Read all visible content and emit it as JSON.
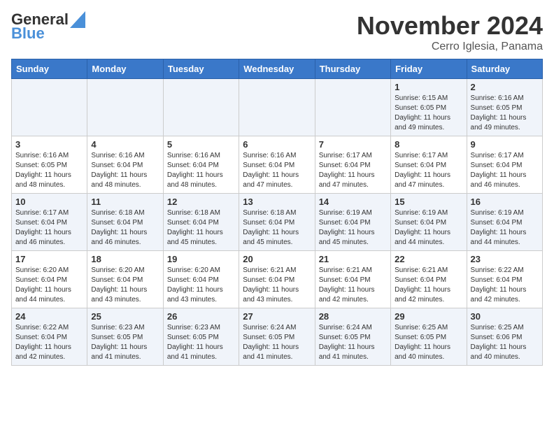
{
  "header": {
    "logo_line1": "General",
    "logo_line2": "Blue",
    "month_title": "November 2024",
    "subtitle": "Cerro Iglesia, Panama"
  },
  "days_of_week": [
    "Sunday",
    "Monday",
    "Tuesday",
    "Wednesday",
    "Thursday",
    "Friday",
    "Saturday"
  ],
  "weeks": [
    [
      {
        "day": "",
        "info": ""
      },
      {
        "day": "",
        "info": ""
      },
      {
        "day": "",
        "info": ""
      },
      {
        "day": "",
        "info": ""
      },
      {
        "day": "",
        "info": ""
      },
      {
        "day": "1",
        "info": "Sunrise: 6:15 AM\nSunset: 6:05 PM\nDaylight: 11 hours and 49 minutes."
      },
      {
        "day": "2",
        "info": "Sunrise: 6:16 AM\nSunset: 6:05 PM\nDaylight: 11 hours and 49 minutes."
      }
    ],
    [
      {
        "day": "3",
        "info": "Sunrise: 6:16 AM\nSunset: 6:05 PM\nDaylight: 11 hours and 48 minutes."
      },
      {
        "day": "4",
        "info": "Sunrise: 6:16 AM\nSunset: 6:04 PM\nDaylight: 11 hours and 48 minutes."
      },
      {
        "day": "5",
        "info": "Sunrise: 6:16 AM\nSunset: 6:04 PM\nDaylight: 11 hours and 48 minutes."
      },
      {
        "day": "6",
        "info": "Sunrise: 6:16 AM\nSunset: 6:04 PM\nDaylight: 11 hours and 47 minutes."
      },
      {
        "day": "7",
        "info": "Sunrise: 6:17 AM\nSunset: 6:04 PM\nDaylight: 11 hours and 47 minutes."
      },
      {
        "day": "8",
        "info": "Sunrise: 6:17 AM\nSunset: 6:04 PM\nDaylight: 11 hours and 47 minutes."
      },
      {
        "day": "9",
        "info": "Sunrise: 6:17 AM\nSunset: 6:04 PM\nDaylight: 11 hours and 46 minutes."
      }
    ],
    [
      {
        "day": "10",
        "info": "Sunrise: 6:17 AM\nSunset: 6:04 PM\nDaylight: 11 hours and 46 minutes."
      },
      {
        "day": "11",
        "info": "Sunrise: 6:18 AM\nSunset: 6:04 PM\nDaylight: 11 hours and 46 minutes."
      },
      {
        "day": "12",
        "info": "Sunrise: 6:18 AM\nSunset: 6:04 PM\nDaylight: 11 hours and 45 minutes."
      },
      {
        "day": "13",
        "info": "Sunrise: 6:18 AM\nSunset: 6:04 PM\nDaylight: 11 hours and 45 minutes."
      },
      {
        "day": "14",
        "info": "Sunrise: 6:19 AM\nSunset: 6:04 PM\nDaylight: 11 hours and 45 minutes."
      },
      {
        "day": "15",
        "info": "Sunrise: 6:19 AM\nSunset: 6:04 PM\nDaylight: 11 hours and 44 minutes."
      },
      {
        "day": "16",
        "info": "Sunrise: 6:19 AM\nSunset: 6:04 PM\nDaylight: 11 hours and 44 minutes."
      }
    ],
    [
      {
        "day": "17",
        "info": "Sunrise: 6:20 AM\nSunset: 6:04 PM\nDaylight: 11 hours and 44 minutes."
      },
      {
        "day": "18",
        "info": "Sunrise: 6:20 AM\nSunset: 6:04 PM\nDaylight: 11 hours and 43 minutes."
      },
      {
        "day": "19",
        "info": "Sunrise: 6:20 AM\nSunset: 6:04 PM\nDaylight: 11 hours and 43 minutes."
      },
      {
        "day": "20",
        "info": "Sunrise: 6:21 AM\nSunset: 6:04 PM\nDaylight: 11 hours and 43 minutes."
      },
      {
        "day": "21",
        "info": "Sunrise: 6:21 AM\nSunset: 6:04 PM\nDaylight: 11 hours and 42 minutes."
      },
      {
        "day": "22",
        "info": "Sunrise: 6:21 AM\nSunset: 6:04 PM\nDaylight: 11 hours and 42 minutes."
      },
      {
        "day": "23",
        "info": "Sunrise: 6:22 AM\nSunset: 6:04 PM\nDaylight: 11 hours and 42 minutes."
      }
    ],
    [
      {
        "day": "24",
        "info": "Sunrise: 6:22 AM\nSunset: 6:04 PM\nDaylight: 11 hours and 42 minutes."
      },
      {
        "day": "25",
        "info": "Sunrise: 6:23 AM\nSunset: 6:05 PM\nDaylight: 11 hours and 41 minutes."
      },
      {
        "day": "26",
        "info": "Sunrise: 6:23 AM\nSunset: 6:05 PM\nDaylight: 11 hours and 41 minutes."
      },
      {
        "day": "27",
        "info": "Sunrise: 6:24 AM\nSunset: 6:05 PM\nDaylight: 11 hours and 41 minutes."
      },
      {
        "day": "28",
        "info": "Sunrise: 6:24 AM\nSunset: 6:05 PM\nDaylight: 11 hours and 41 minutes."
      },
      {
        "day": "29",
        "info": "Sunrise: 6:25 AM\nSunset: 6:05 PM\nDaylight: 11 hours and 40 minutes."
      },
      {
        "day": "30",
        "info": "Sunrise: 6:25 AM\nSunset: 6:06 PM\nDaylight: 11 hours and 40 minutes."
      }
    ]
  ]
}
